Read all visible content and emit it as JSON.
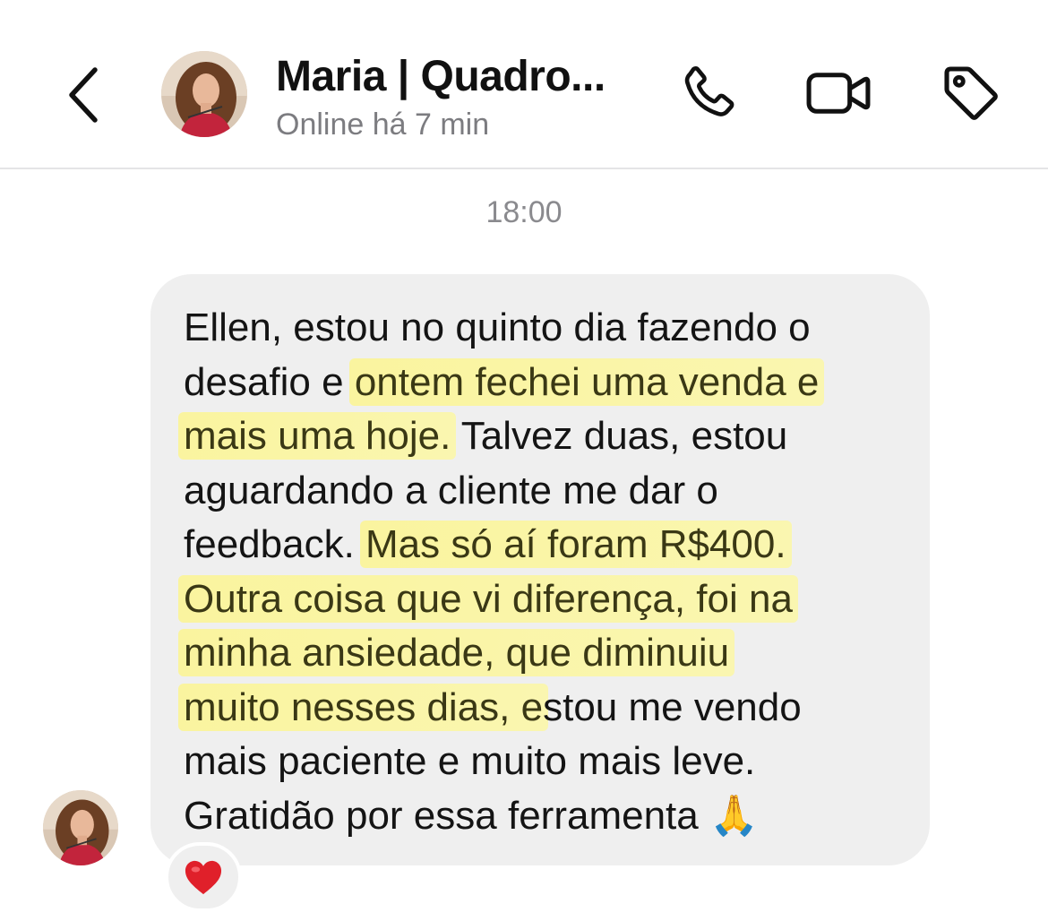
{
  "header": {
    "back_icon": "chevron-left-icon",
    "contact_name": "Maria | Quadro...",
    "status": "Online há 7 min",
    "icons": [
      "phone-icon",
      "video-camera-icon",
      "tag-icon"
    ]
  },
  "chat": {
    "timestamp": "18:00",
    "message": {
      "lines": [
        [
          {
            "t": "Ellen, estou no quinto dia fazendo o",
            "hl": false
          }
        ],
        [
          {
            "t": "desafio e ",
            "hl": false
          },
          {
            "t": "ontem fechei uma venda e",
            "hl": true
          }
        ],
        [
          {
            "t": "mais uma hoje.",
            "hl": true
          },
          {
            "t": " Talvez duas, estou",
            "hl": false
          }
        ],
        [
          {
            "t": "aguardando a cliente me dar o",
            "hl": false
          }
        ],
        [
          {
            "t": "feedback. ",
            "hl": false
          },
          {
            "t": "Mas só aí foram R$400.",
            "hl": true
          }
        ],
        [
          {
            "t": "Outra coisa que vi diferença, foi na",
            "hl": true
          }
        ],
        [
          {
            "t": "minha ansiedade, que diminuiu",
            "hl": true
          }
        ],
        [
          {
            "t": "muito nesses dias, e",
            "hl": true
          },
          {
            "t": "stou me vendo",
            "hl": false
          }
        ],
        [
          {
            "t": "mais paciente e muito mais leve.",
            "hl": false
          }
        ],
        [
          {
            "t": "Gratidão por essa ferramenta ",
            "hl": false
          },
          {
            "t": "🙏",
            "hl": false,
            "emoji": true
          }
        ]
      ]
    },
    "reaction": "❤"
  },
  "colors": {
    "bubble": "#efefef",
    "highlight": "#fbf596",
    "heart": "#e0202a",
    "status_gray": "#7c7c80"
  }
}
